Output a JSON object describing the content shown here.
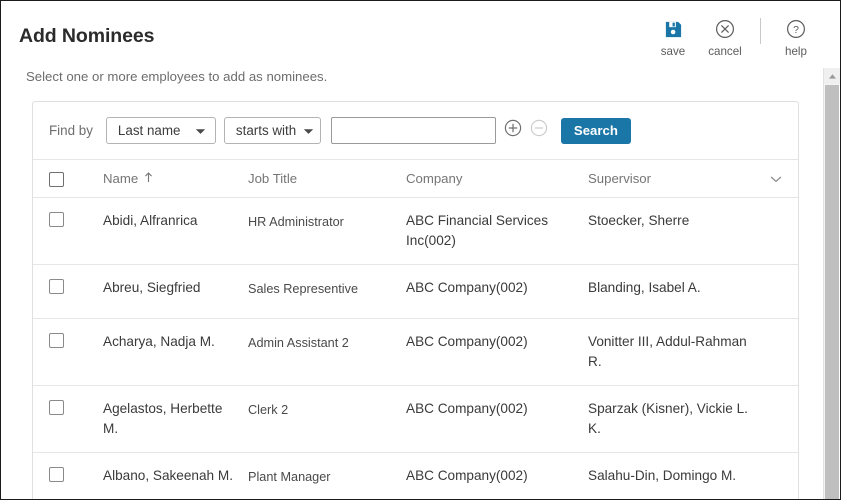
{
  "header": {
    "title": "Add Nominees",
    "subtitle": "Select one or more employees to add as nominees.",
    "toolbar": [
      {
        "label": "save",
        "icon": "save-icon",
        "color": "#1b76a8"
      },
      {
        "label": "cancel",
        "icon": "cancel-icon",
        "color": "#5c5c5c"
      },
      {
        "label": "help",
        "icon": "help-icon",
        "color": "#5c5c5c"
      }
    ]
  },
  "findbar": {
    "label": "Find by",
    "field_select": {
      "value": "Last name",
      "icon": "chevron-down-icon"
    },
    "operator_select": {
      "value": "starts with",
      "icon": "chevron-down-icon"
    },
    "search_input": {
      "value": "",
      "placeholder": ""
    },
    "add_criteria_icon": "plus-circle-icon",
    "remove_criteria_icon": "minus-circle-icon",
    "search_button": "Search"
  },
  "table": {
    "select_all_checkbox": false,
    "columns": [
      {
        "label": "Name",
        "sort": "ascending",
        "sort_icon": "arrow-up-icon"
      },
      {
        "label": "Job Title",
        "sort": "none"
      },
      {
        "label": "Company",
        "sort": "none"
      },
      {
        "label": "Supervisor",
        "sort": "none"
      }
    ],
    "column_menu_icon": "chevron-down-icon",
    "rows": [
      {
        "checked": false,
        "name": "Abidi, Alfranrica",
        "job_title": "HR Administrator",
        "company": "ABC Financial Services Inc(002)",
        "supervisor": "Stoecker, Sherre"
      },
      {
        "checked": false,
        "name": "Abreu, Siegfried",
        "job_title": "Sales Representive",
        "company": "ABC Company(002)",
        "supervisor": "Blanding, Isabel A."
      },
      {
        "checked": false,
        "name": "Acharya, Nadja M.",
        "job_title": "Admin Assistant 2",
        "company": "ABC Company(002)",
        "supervisor": "Vonitter III, Addul-Rahman R."
      },
      {
        "checked": false,
        "name": "Agelastos, Herbette M.",
        "job_title": "Clerk 2",
        "company": "ABC Company(002)",
        "supervisor": "Sparzak (Kisner), Vickie L. K."
      },
      {
        "checked": false,
        "name": "Albano, Sakeenah M.",
        "job_title": "Plant Manager",
        "company": "ABC Company(002)",
        "supervisor": "Salahu-Din, Domingo M."
      }
    ]
  },
  "scrollbar": {
    "up_arrow_icon": "triangle-up-icon",
    "orientation": "vertical"
  },
  "colors": {
    "accent": "#1b76a8",
    "text": "#3a3a3a",
    "muted": "#757575",
    "border": "#e6e6e6"
  }
}
